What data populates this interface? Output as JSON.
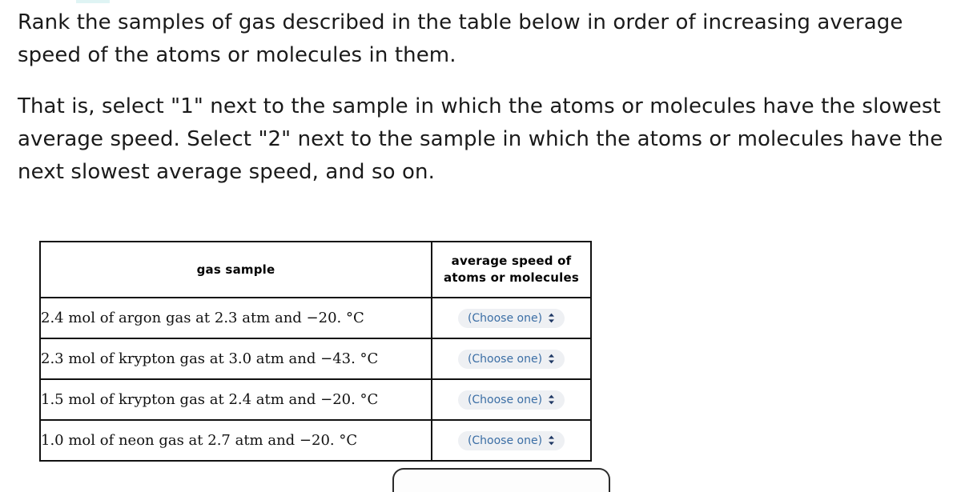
{
  "prompt": {
    "paragraph_1": "Rank the samples of gas described in the table below in order of increasing average speed of the atoms or molecules in them.",
    "paragraph_2": "That is, select \"1\" next to the sample in which the atoms or molecules have the slowest average speed. Select \"2\" next to the sample in which the atoms or molecules have the next slowest average speed, and so on."
  },
  "table": {
    "headers": {
      "gas_sample": "gas sample",
      "average_speed_line1": "average speed of",
      "average_speed_line2": "atoms or molecules"
    },
    "rows": [
      {
        "sample": "2.4 mol of argon gas at 2.3 atm and −20. °C",
        "speed_select": "(Choose one)"
      },
      {
        "sample": "2.3 mol of krypton gas at 3.0 atm and −43. °C",
        "speed_select": "(Choose one)"
      },
      {
        "sample": "1.5 mol of krypton gas at 2.4 atm and −20. °C",
        "speed_select": "(Choose one)"
      },
      {
        "sample": "1.0 mol of neon gas at 2.7 atm and −20. °C",
        "speed_select": "(Choose one)"
      }
    ]
  },
  "colors": {
    "select_text": "#3b6ea5",
    "select_background": "#eef0f3",
    "table_border": "#111111",
    "body_text": "#1a1a1a"
  }
}
